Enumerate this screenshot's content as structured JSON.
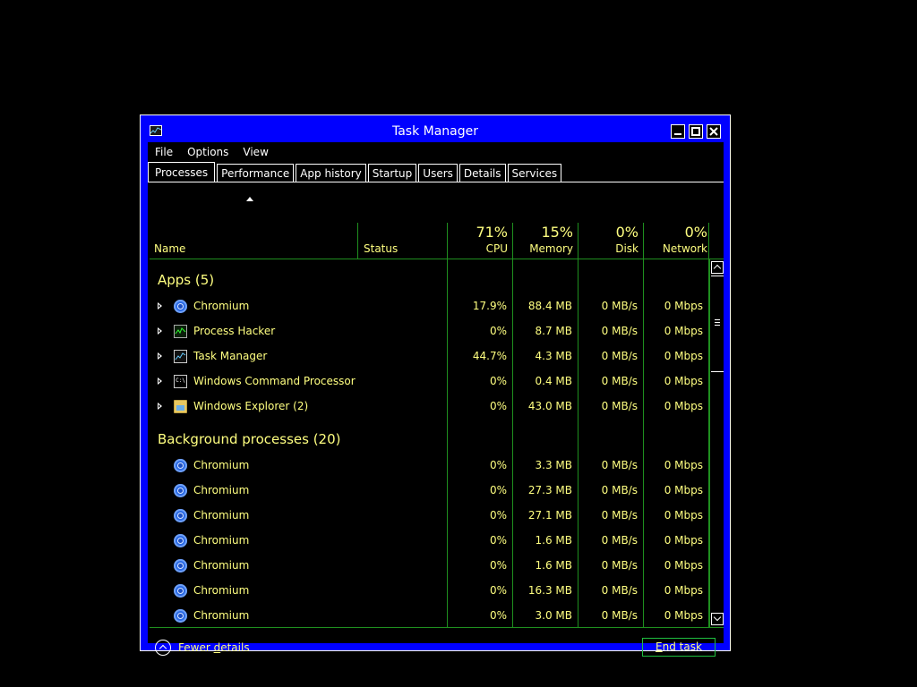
{
  "window": {
    "title": "Task Manager"
  },
  "menu": [
    "File",
    "Options",
    "View"
  ],
  "tabs": [
    "Processes",
    "Performance",
    "App history",
    "Startup",
    "Users",
    "Details",
    "Services"
  ],
  "active_tab": "Processes",
  "columns": {
    "name": "Name",
    "status": "Status",
    "cpu": {
      "label": "CPU",
      "pct": "71%"
    },
    "memory": {
      "label": "Memory",
      "pct": "15%"
    },
    "disk": {
      "label": "Disk",
      "pct": "0%"
    },
    "network": {
      "label": "Network",
      "pct": "0%"
    }
  },
  "groups": {
    "apps": "Apps (5)",
    "background": "Background processes (20)"
  },
  "apps": [
    {
      "name": "Chromium",
      "icon": "chromium-icon",
      "cpu": "17.9%",
      "memory": "88.4 MB",
      "disk": "0 MB/s",
      "network": "0 Mbps"
    },
    {
      "name": "Process Hacker",
      "icon": "process-hacker-icon",
      "cpu": "0%",
      "memory": "8.7 MB",
      "disk": "0 MB/s",
      "network": "0 Mbps"
    },
    {
      "name": "Task Manager",
      "icon": "task-manager-icon",
      "cpu": "44.7%",
      "memory": "4.3 MB",
      "disk": "0 MB/s",
      "network": "0 Mbps"
    },
    {
      "name": "Windows Command Processor",
      "icon": "command-prompt-icon",
      "cpu": "0%",
      "memory": "0.4 MB",
      "disk": "0 MB/s",
      "network": "0 Mbps"
    },
    {
      "name": "Windows Explorer (2)",
      "icon": "explorer-icon",
      "cpu": "0%",
      "memory": "43.0 MB",
      "disk": "0 MB/s",
      "network": "0 Mbps"
    }
  ],
  "background": [
    {
      "name": "Chromium",
      "cpu": "0%",
      "memory": "3.3 MB",
      "disk": "0 MB/s",
      "network": "0 Mbps"
    },
    {
      "name": "Chromium",
      "cpu": "0%",
      "memory": "27.3 MB",
      "disk": "0 MB/s",
      "network": "0 Mbps"
    },
    {
      "name": "Chromium",
      "cpu": "0%",
      "memory": "27.1 MB",
      "disk": "0 MB/s",
      "network": "0 Mbps"
    },
    {
      "name": "Chromium",
      "cpu": "0%",
      "memory": "1.6 MB",
      "disk": "0 MB/s",
      "network": "0 Mbps"
    },
    {
      "name": "Chromium",
      "cpu": "0%",
      "memory": "1.6 MB",
      "disk": "0 MB/s",
      "network": "0 Mbps"
    },
    {
      "name": "Chromium",
      "cpu": "0%",
      "memory": "16.3 MB",
      "disk": "0 MB/s",
      "network": "0 Mbps"
    },
    {
      "name": "Chromium",
      "cpu": "0%",
      "memory": "3.0 MB",
      "disk": "0 MB/s",
      "network": "0 Mbps"
    }
  ],
  "footer": {
    "fewer_details_pre": "Fewer ",
    "fewer_details_accel": "d",
    "fewer_details_post": "etails",
    "end_task_accel": "E",
    "end_task_post": "nd task"
  },
  "colors": {
    "window_frame": "#0000ff",
    "text": "#ffff80",
    "grid_lines": "#1f8f1f",
    "background": "#000000"
  }
}
